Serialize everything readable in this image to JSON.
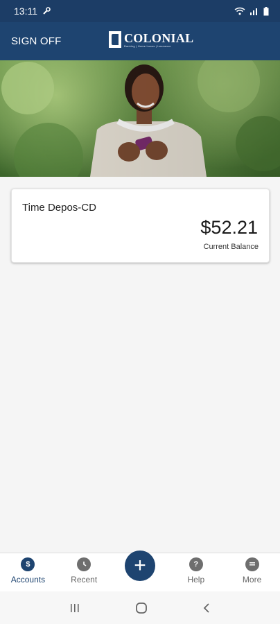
{
  "status": {
    "time": "13:11"
  },
  "header": {
    "sign_off": "SIGN OFF",
    "logo_title": "COLONIAL",
    "logo_sub": "Banking | Home Loans | Insurance"
  },
  "account": {
    "name": "Time Depos-CD",
    "balance": "$52.21",
    "caption": "Current Balance"
  },
  "nav": {
    "accounts": "Accounts",
    "recent": "Recent",
    "help": "Help",
    "more": "More",
    "add": "+"
  },
  "colors": {
    "primary": "#1e4470",
    "status_bar": "#1c3d66",
    "background": "#f5f5f5"
  }
}
